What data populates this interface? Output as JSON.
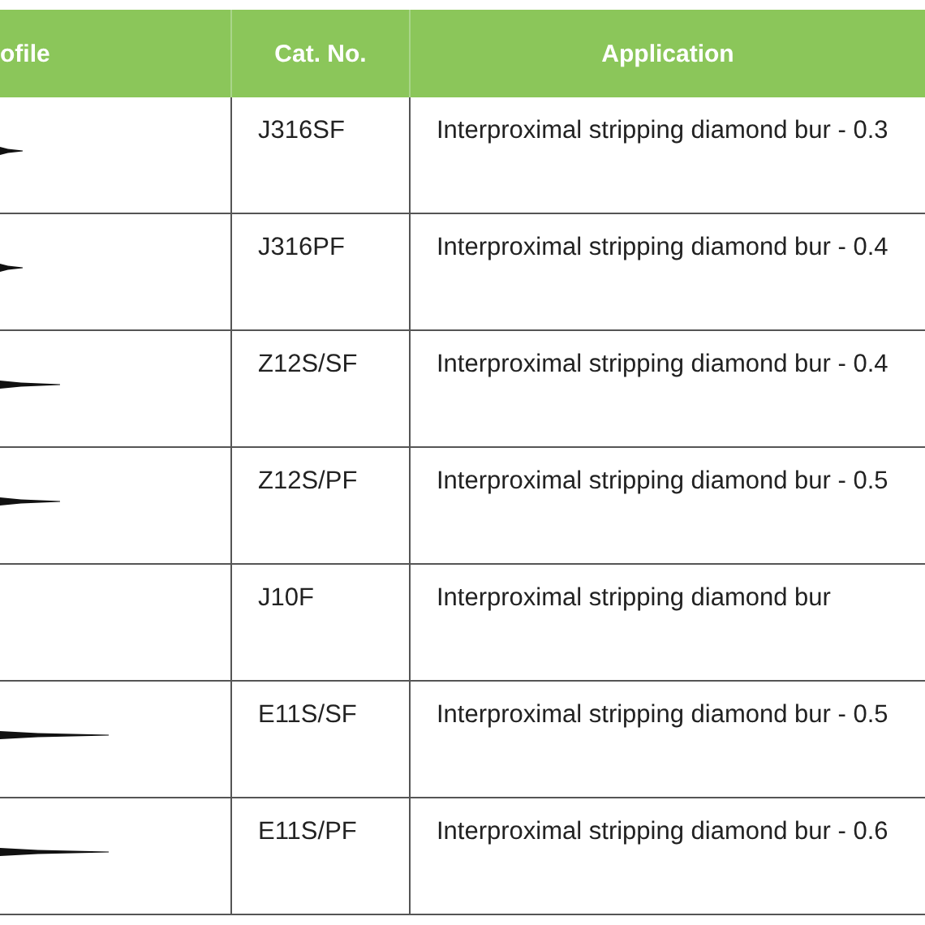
{
  "table": {
    "columns": [
      "ofile",
      "Cat. No.",
      "Application"
    ],
    "rows": [
      {
        "kind": "short",
        "cat_no": "J316SF",
        "application": "Interproximal stripping diamond bur - 0.3"
      },
      {
        "kind": "short",
        "cat_no": "J316PF",
        "application": "Interproximal stripping diamond bur - 0.4"
      },
      {
        "kind": "medium",
        "cat_no": "Z12S/SF",
        "application": "Interproximal stripping diamond bur - 0.4"
      },
      {
        "kind": "medium",
        "cat_no": "Z12S/PF",
        "application": "Interproximal stripping diamond bur - 0.5"
      },
      {
        "kind": "empty",
        "cat_no": "J10F",
        "application": "Interproximal stripping diamond bur"
      },
      {
        "kind": "long",
        "cat_no": "E11S/SF",
        "application": "Interproximal stripping diamond bur - 0.5"
      },
      {
        "kind": "long",
        "cat_no": "E11S/PF",
        "application": "Interproximal stripping diamond bur - 0.6"
      }
    ]
  }
}
